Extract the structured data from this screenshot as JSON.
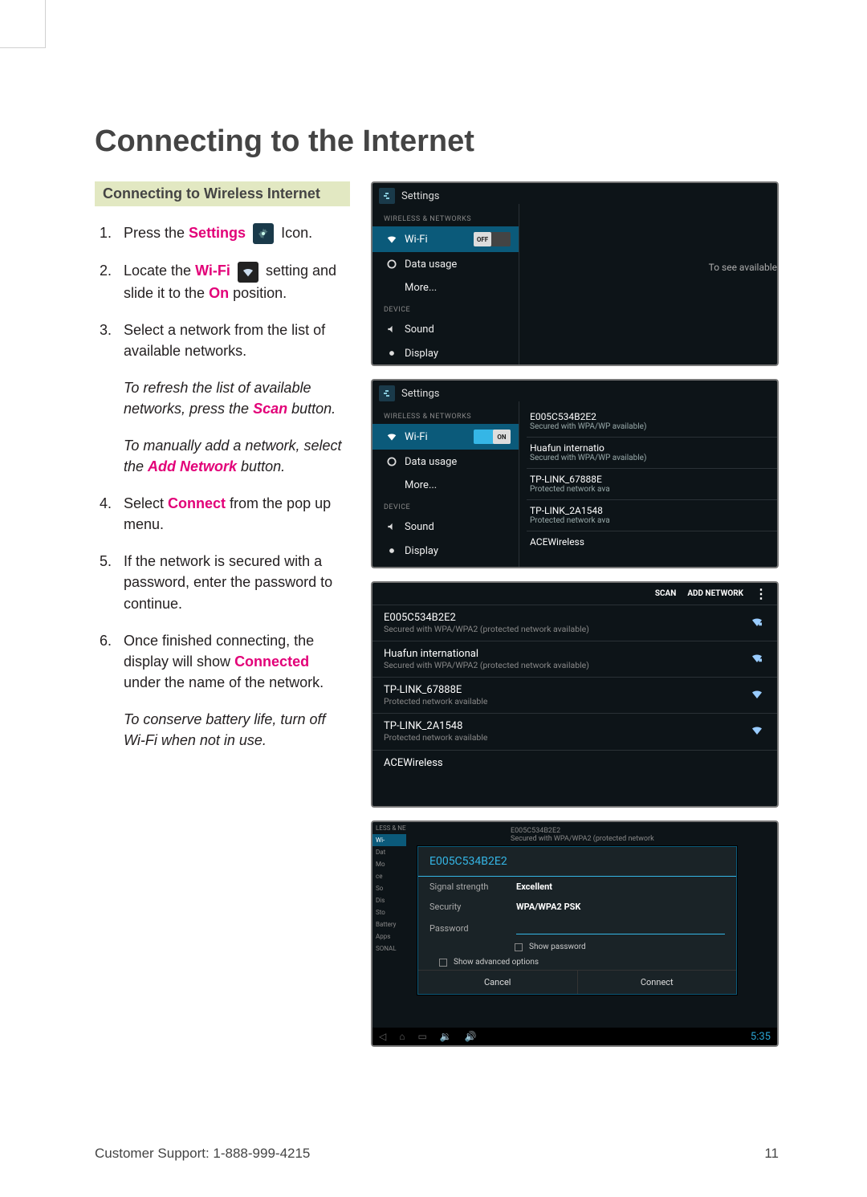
{
  "page": {
    "title": "Connecting to the Internet",
    "subhead": "Connecting to Wireless Internet",
    "footer_left": "Customer Support: 1-888-999-4215",
    "footer_right": "11"
  },
  "steps": {
    "s1a": "Press the ",
    "s1_hl": "Settings",
    "s1b": " Icon.",
    "s2a": "Locate the ",
    "s2_hl1": "Wi-Fi",
    "s2b": " setting and slide it to the ",
    "s2_hl2": "On",
    "s2c": " position.",
    "s3": "Select a network from the list of available networks.",
    "note1a": "To refresh the list of available networks, press the ",
    "note1_hl": "Scan",
    "note1b": " button.",
    "note2a": "To manually add a network, select the ",
    "note2_hl": "Add Network",
    "note2b": " button.",
    "s4a": "Select ",
    "s4_hl": "Connect",
    "s4b": " from the pop up menu.",
    "s5": "If the network is secured with a password, enter the password to continue.",
    "s6a": "Once finished connecting, the display will show ",
    "s6_hl": "Connected",
    "s6b": " under the name of the network.",
    "note3": "To conserve battery life, turn off Wi-Fi when not in use."
  },
  "ui": {
    "settings_label": "Settings",
    "section_wireless": "WIRELESS & NETWORKS",
    "section_device": "DEVICE",
    "wifi": "Wi-Fi",
    "data_usage": "Data usage",
    "more": "More...",
    "sound": "Sound",
    "display": "Display",
    "storage": "Storage",
    "battery": "Battery",
    "apps": "Apps",
    "toggle_off": "OFF",
    "toggle_on": "ON",
    "msg_off": "To see available",
    "scan": "SCAN",
    "add_network": "ADD NETWORK"
  },
  "networks": [
    {
      "name": "E005C534B2E2",
      "sub": "Secured with WPA/WPA2 (protected network available)",
      "sub_short": "Secured with WPA/WP\navailable)"
    },
    {
      "name": "Huafun international",
      "name_short": "Huafun internatio",
      "sub": "Secured with WPA/WPA2 (protected network available)",
      "sub_short": "Secured with WPA/WP\navailable)"
    },
    {
      "name": "TP-LINK_67888E",
      "sub": "Protected network available",
      "sub_short": "Protected network ava"
    },
    {
      "name": "TP-LINK_2A1548",
      "sub": "Protected network available",
      "sub_short": "Protected network ava"
    },
    {
      "name": "ACEWireless",
      "sub": ""
    }
  ],
  "dialog": {
    "title": "E005C534B2E2",
    "signal_label": "Signal strength",
    "signal_val": "Excellent",
    "security_label": "Security",
    "security_val": "WPA/WPA2 PSK",
    "password_label": "Password",
    "show_password": "Show password",
    "show_advanced": "Show advanced options",
    "cancel": "Cancel",
    "connect": "Connect",
    "clock": "5:35",
    "bg_net_name": "E005C534B2E2",
    "bg_net_sub": "Secured with WPA/WPA2 (protected network"
  },
  "mini": {
    "less": "LESS & NETWORKS",
    "wi": "Wi-",
    "dat": "Dat",
    "mo": "Mo",
    "ce": "ce",
    "so": "So",
    "dis": "Dis",
    "sto": "Sto",
    "sonal": "SONAL"
  }
}
